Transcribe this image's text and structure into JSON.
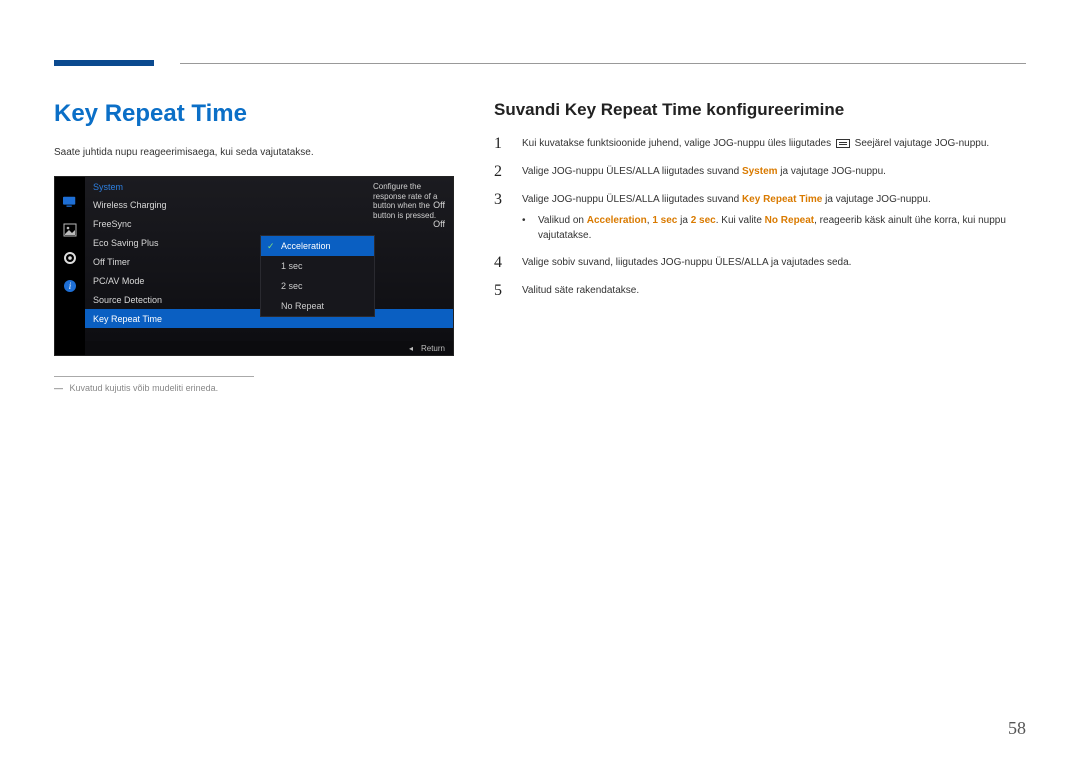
{
  "page_number": "58",
  "title": "Key Repeat Time",
  "intro": "Saate juhtida nupu reageerimisaega, kui seda vajutatakse.",
  "footnote": "Kuvatud kujutis võib mudeliti erineda.",
  "osd": {
    "header": "System",
    "tooltip": "Configure the response rate of a button when the button is pressed.",
    "items": [
      {
        "label": "Wireless Charging",
        "value": "Off"
      },
      {
        "label": "FreeSync",
        "value": "Off"
      },
      {
        "label": "Eco Saving Plus",
        "value": ""
      },
      {
        "label": "Off Timer",
        "value": ""
      },
      {
        "label": "PC/AV Mode",
        "value": ""
      },
      {
        "label": "Source Detection",
        "value": ""
      },
      {
        "label": "Key Repeat Time",
        "value": ""
      }
    ],
    "selected_index": 6,
    "submenu": [
      "Acceleration",
      "1 sec",
      "2 sec",
      "No Repeat"
    ],
    "submenu_selected": 0,
    "footer_return": "Return",
    "footer_arrow": "◂"
  },
  "right": {
    "heading": "Suvandi Key Repeat Time konfigureerimine",
    "steps": {
      "s1a": "Kui kuvatakse funktsioonide juhend, valige JOG-nuppu üles liigutades ",
      "s1b": " Seejärel vajutage JOG-nuppu.",
      "s2a": "Valige JOG-nuppu ÜLES/ALLA liigutades suvand ",
      "s2_hl": "System",
      "s2b": " ja vajutage JOG-nuppu.",
      "s3a": "Valige JOG-nuppu ÜLES/ALLA liigutades suvand ",
      "s3_hl": "Key Repeat Time",
      "s3b": " ja vajutage JOG-nuppu.",
      "bullet_a": "Valikud on ",
      "bullet_h1": "Acceleration",
      "bullet_m1": ", ",
      "bullet_h2": "1 sec",
      "bullet_m2": " ja ",
      "bullet_h3": "2 sec",
      "bullet_m3": ". Kui valite ",
      "bullet_h4": "No Repeat",
      "bullet_b": ", reageerib käsk ainult ühe korra, kui nuppu vajutatakse.",
      "s4": "Valige sobiv suvand, liigutades JOG-nuppu ÜLES/ALLA ja vajutades seda.",
      "s5": "Valitud säte rakendatakse."
    },
    "nums": {
      "n1": "1",
      "n2": "2",
      "n3": "3",
      "n4": "4",
      "n5": "5"
    }
  }
}
